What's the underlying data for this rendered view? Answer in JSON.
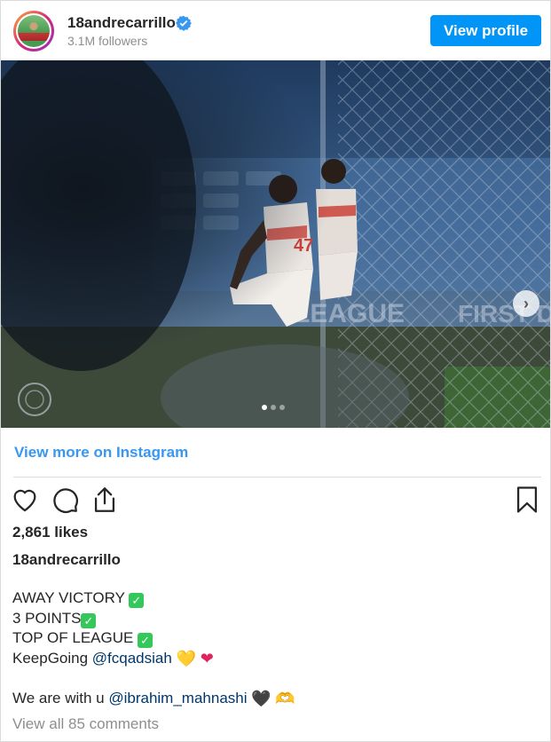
{
  "header": {
    "username": "18andrecarrillo",
    "followers": "3.1M followers",
    "view_profile_label": "View profile"
  },
  "post": {
    "image_alt": "Two players celebrating on a football pitch behind a goal net",
    "image_overlay_text": [
      "LEAGUE",
      "FIRST DIV"
    ],
    "carousel": {
      "count": 3,
      "active_index": 0
    },
    "next_icon": "›"
  },
  "view_more_label": "View more on Instagram",
  "actions": {
    "like_icon": "heart-icon",
    "comment_icon": "comment-icon",
    "share_icon": "share-icon",
    "save_icon": "bookmark-icon"
  },
  "likes": "2,861 likes",
  "caption": {
    "username": "18andrecarrillo",
    "lines": [
      {
        "text": "AWAY VICTORY ",
        "emojis": [
          "✓"
        ]
      },
      {
        "text": "3 POINTS",
        "emojis": [
          "✓"
        ]
      },
      {
        "text": "TOP OF LEAGUE ",
        "emojis": [
          "✓"
        ]
      },
      {
        "text": "KeepGoing ",
        "mention": "@fcqadsiah",
        "emojis": [
          "💛",
          "❤"
        ]
      },
      {
        "text": ""
      },
      {
        "text": "We are with u ",
        "mention": "@ibrahim_mahnashi",
        "emojis": [
          "🖤",
          "🫶"
        ]
      }
    ]
  },
  "view_comments_label": "View all 85 comments",
  "colors": {
    "accent": "#0095f6",
    "link": "#3897f0",
    "mention": "#00376b",
    "muted": "#8e8e8e",
    "check_green": "#34c759"
  }
}
